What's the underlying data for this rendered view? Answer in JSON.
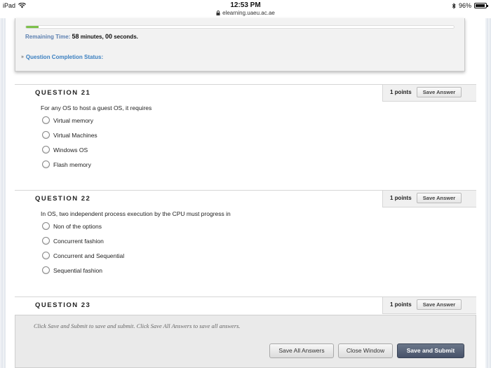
{
  "status_bar": {
    "device": "iPad",
    "wifi_icon": "wifi-icon",
    "time": "12:53 PM",
    "url": "elearning.uaeu.ac.ae",
    "lock_icon": "lock-icon",
    "bluetooth_icon": "bluetooth-icon",
    "battery": "96%",
    "battery_level": 0.96
  },
  "timer": {
    "label": "Remaining Time:",
    "minutes": "58",
    "minutes_label": "minutes,",
    "seconds": "00",
    "seconds_label": "seconds.",
    "progress": 0.03,
    "progress_color": "#7cc04a",
    "completion_status": "Question Completion Status:"
  },
  "questions": [
    {
      "title": "QUESTION 21",
      "points": "1 points",
      "save_label": "Save Answer",
      "text": "For any OS to host a guest OS, it requires",
      "options": [
        "Virtual memory",
        "Virtual Machines",
        "Windows OS",
        "Flash memory"
      ]
    },
    {
      "title": "QUESTION 22",
      "points": "1 points",
      "save_label": "Save Answer",
      "text": "In OS, two independent process execution by the CPU must progress in",
      "options": [
        "Non of the options",
        "Concurrent fashion",
        "Concurrent and Sequential",
        "Sequential fashion"
      ]
    },
    {
      "title": "QUESTION 23",
      "points": "1 points",
      "save_label": "Save Answer"
    }
  ],
  "footer": {
    "note": "Click Save and Submit to save and submit. Click Save All Answers to save all answers.",
    "save_all": "Save All Answers",
    "close_window": "Close Window",
    "save_submit": "Save and Submit"
  }
}
